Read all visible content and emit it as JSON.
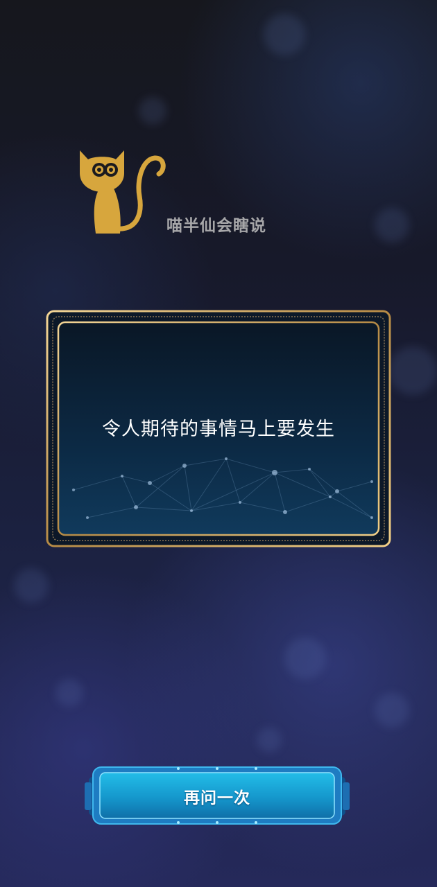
{
  "header": {
    "app_title": "喵半仙会瞎说",
    "logo_icon": "cat-icon",
    "logo_color": "#d7a63d"
  },
  "fortune_card": {
    "message": "令人期待的事情马上要发生",
    "border_color": "#c9a261"
  },
  "actions": {
    "ask_again_label": "再问一次"
  },
  "colors": {
    "button_blue": "#1aa5d8",
    "title_gray": "#a7a7a9"
  }
}
